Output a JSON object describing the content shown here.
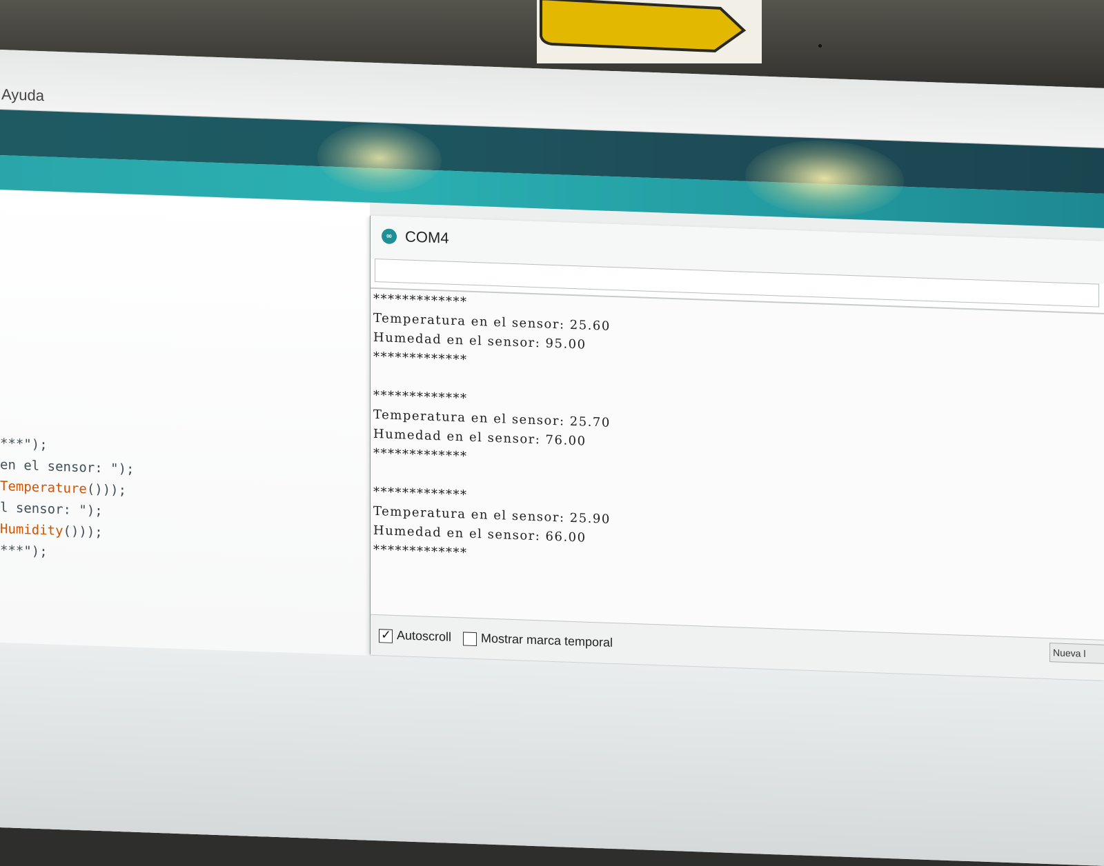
{
  "menubar": {
    "visible_item": "Ayuda"
  },
  "editor": {
    "code_lines": [
      {
        "text": "***\");",
        "highlight": ""
      },
      {
        "text": "en el sensor: \");",
        "highlight": ""
      },
      {
        "text": "()));",
        "highlight": "Temperature"
      },
      {
        "text": "l sensor: \");",
        "highlight": ""
      },
      {
        "text": "()));",
        "highlight": "Humidity"
      },
      {
        "text": "***\");",
        "highlight": ""
      }
    ]
  },
  "serial_monitor": {
    "title": "COM4",
    "logo_icon": "arduino-logo-icon",
    "send_input_value": "",
    "output_lines": [
      "*************",
      "Temperatura en el sensor: 25.60",
      "Humedad en el sensor: 95.00",
      "*************",
      "",
      "*************",
      "Temperatura en el sensor: 25.70",
      "Humedad en el sensor: 76.00",
      "*************",
      "",
      "*************",
      "Temperatura en el sensor: 25.90",
      "Humedad en el sensor: 66.00",
      "*************"
    ],
    "autoscroll_label": "Autoscroll",
    "autoscroll_checked": true,
    "timestamp_label": "Mostrar marca temporal",
    "timestamp_checked": false,
    "line_ending_value": "Nueva l"
  },
  "colors": {
    "toolbar_dark": "#1d5962",
    "toolbar_teal": "#2bb0b2",
    "code_function": "#d35400",
    "sticker_yellow": "#e3b800"
  }
}
